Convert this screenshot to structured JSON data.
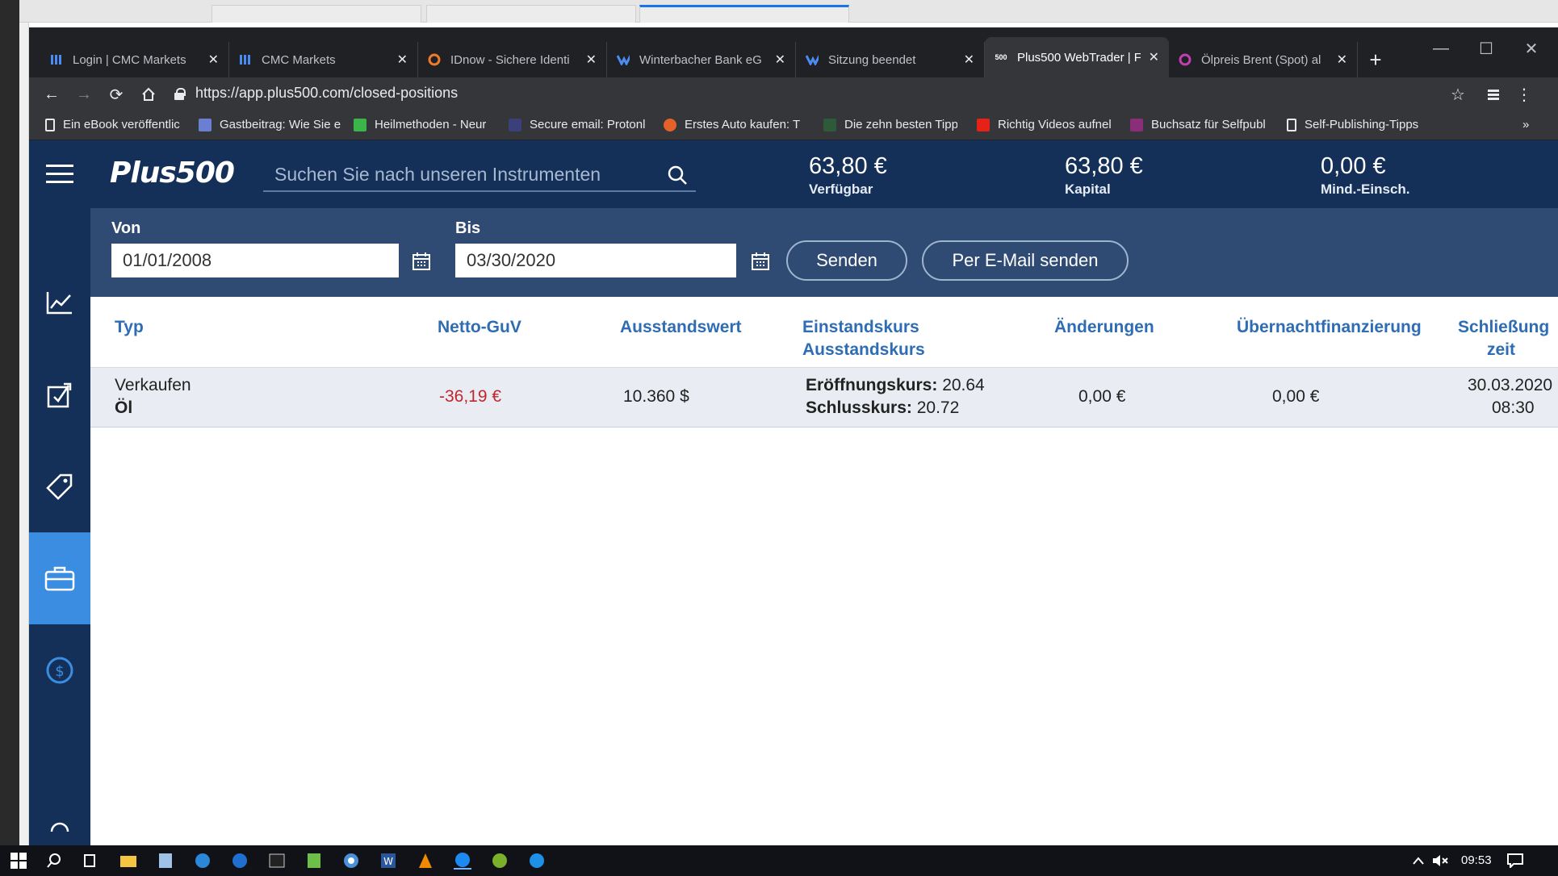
{
  "browser": {
    "tabs": [
      {
        "label": "Login | CMC Markets",
        "icon": "cmc-icon"
      },
      {
        "label": "CMC Markets",
        "icon": "cmc-icon"
      },
      {
        "label": "IDnow - Sichere Identi",
        "icon": "idnow-icon"
      },
      {
        "label": "Winterbacher Bank eG",
        "icon": "volksbank-icon"
      },
      {
        "label": "Sitzung beendet",
        "icon": "volksbank-icon"
      },
      {
        "label": "Plus500 WebTrader | F",
        "icon": "plus500-icon",
        "active": true
      },
      {
        "label": "Ölpreis Brent (Spot) al",
        "icon": "globe-icon"
      }
    ],
    "url": "https://app.plus500.com/closed-positions",
    "bookmarks": [
      {
        "label": "Ein eBook veröffentlic",
        "icon": "page-icon"
      },
      {
        "label": "Gastbeitrag: Wie Sie e",
        "icon": "site-icon"
      },
      {
        "label": "Heilmethoden - Neur",
        "icon": "plus-icon"
      },
      {
        "label": "Secure email: Protonl",
        "icon": "proton-icon"
      },
      {
        "label": "Erstes Auto kaufen: T",
        "icon": "site-icon"
      },
      {
        "label": "Die zehn besten Tipp",
        "icon": "site-icon"
      },
      {
        "label": "Richtig Videos aufnel",
        "icon": "youtube-icon"
      },
      {
        "label": "Buchsatz für Selfpubl",
        "icon": "site-icon"
      },
      {
        "label": "Self-Publishing-Tipps",
        "icon": "page-icon"
      }
    ],
    "bookmarks_more": "»"
  },
  "app": {
    "logo": "Plus500",
    "search_placeholder": "Suchen Sie nach unseren Instrumenten",
    "stats": [
      {
        "value": "63,80 €",
        "label": "Verfügbar"
      },
      {
        "value": "63,80 €",
        "label": "Kapital"
      },
      {
        "value": "0,00 €",
        "label": "Mind.-Einsch."
      }
    ],
    "filter": {
      "from_label": "Von",
      "from_value": "01/01/2008",
      "to_label": "Bis",
      "to_value": "03/30/2020",
      "send_button": "Senden",
      "email_button": "Per E-Mail senden"
    },
    "table": {
      "headers": {
        "type": "Typ",
        "pnl": "Netto-GuV",
        "exposure": "Ausstandswert",
        "rate_1": "Einstandskurs",
        "rate_2": "Ausstandskurs",
        "changes": "Änderungen",
        "overnight": "Übernachtfinanzierung",
        "close_time_1": "Schließung",
        "close_time_2": "zeit"
      },
      "rows": [
        {
          "direction": "Verkaufen",
          "instrument": "Öl",
          "pnl": "-36,19 €",
          "exposure": "10.360 $",
          "open_label": "Eröffnungskurs:",
          "open_value": "20.64",
          "close_label": "Schlusskurs:",
          "close_value": "20.72",
          "changes": "0,00 €",
          "overnight": "0,00 €",
          "close_date": "30.03.2020",
          "close_time": "08:30"
        }
      ]
    },
    "colors": {
      "navy": "#143058",
      "filter": "#2f4a73",
      "accent": "#3a8de0",
      "header_text": "#2e6db4",
      "loss": "#c0272d"
    }
  },
  "taskbar": {
    "time": "09:53"
  }
}
